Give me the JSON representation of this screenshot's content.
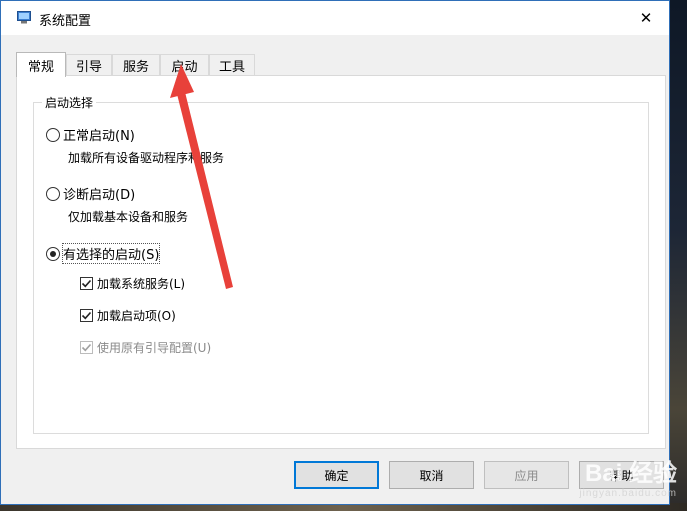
{
  "window": {
    "title": "系统配置",
    "close_glyph": "✕"
  },
  "tabs": [
    {
      "label": "常规",
      "active": true
    },
    {
      "label": "引导",
      "active": false
    },
    {
      "label": "服务",
      "active": false
    },
    {
      "label": "启动",
      "active": false
    },
    {
      "label": "工具",
      "active": false
    }
  ],
  "startup_selection": {
    "group_label": "启动选择",
    "normal": {
      "label": "正常启动(N)",
      "description": "加载所有设备驱动程序和服务",
      "checked": false
    },
    "diagnostic": {
      "label": "诊断启动(D)",
      "description": "仅加载基本设备和服务",
      "checked": false
    },
    "selective": {
      "label": "有选择的启动(S)",
      "checked": true,
      "options": [
        {
          "label": "加载系统服务(L)",
          "checked": true,
          "enabled": true
        },
        {
          "label": "加载启动项(O)",
          "checked": true,
          "enabled": true
        },
        {
          "label": "使用原有引导配置(U)",
          "checked": true,
          "enabled": false
        }
      ]
    }
  },
  "buttons": {
    "ok": "确定",
    "cancel": "取消",
    "apply": "应用",
    "help": "帮助"
  },
  "annotation": {
    "arrow_color": "#e8413a"
  },
  "watermark": {
    "main": "Bai 经验",
    "sub": "jingyan.baidu.com"
  }
}
